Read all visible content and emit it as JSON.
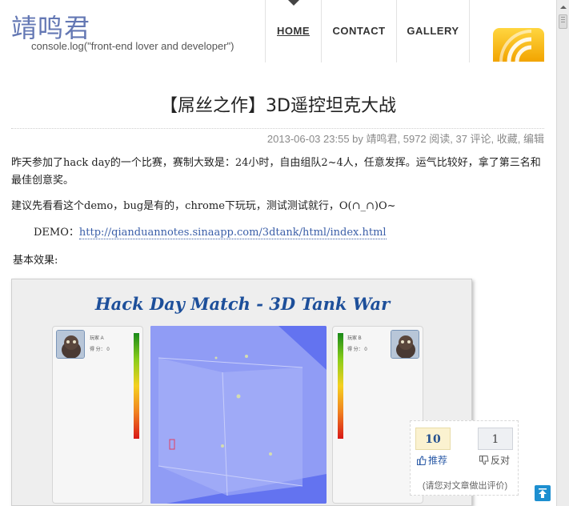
{
  "site": {
    "title": "靖鸣君",
    "subtitle": "console.log(\"front-end lover and developer\")"
  },
  "nav": [
    {
      "label": "HOME",
      "active": true
    },
    {
      "label": "CONTACT",
      "active": false
    },
    {
      "label": "GALLERY",
      "active": false
    }
  ],
  "rss_icon": "rss-feed-icon",
  "post": {
    "title": "【屌丝之作】3D遥控坦克大战",
    "meta": "2013-06-03 23:55 by 靖鸣君, 5972 阅读, 37 评论, 收藏, 编辑",
    "paragraphs": [
      "昨天参加了hack day的一个比赛，赛制大致是：24小时，自由组队2~4人，任意发挥。运气比较好，拿了第三名和最佳创意奖。",
      "建议先看看这个demo，bug是有的，chrome下玩玩，测试测试就行，O(∩_∩)O~"
    ],
    "demo_label": "DEMO：",
    "demo_link": "http://qianduannotes.sinaapp.com/3dtank/html/index.html",
    "effect_label": "基本效果:"
  },
  "game": {
    "title": "Hack Day Match - 3D Tank War",
    "player_a": {
      "name": "玩家 A",
      "score": "得 分：  0"
    },
    "player_b": {
      "name": "玩家 B",
      "score": "得 分：  0"
    },
    "colors": {
      "arena": "#6373f0",
      "title": "#1d4f9a"
    }
  },
  "rating": {
    "up_count": "10",
    "down_count": "1",
    "up_label": "推荐",
    "down_label": "反对",
    "hint": "(请您对文章做出评价)"
  },
  "icons": [
    "thumb-up-icon",
    "thumb-down-icon",
    "back-to-top-icon",
    "scroll-up-arrow-icon"
  ]
}
